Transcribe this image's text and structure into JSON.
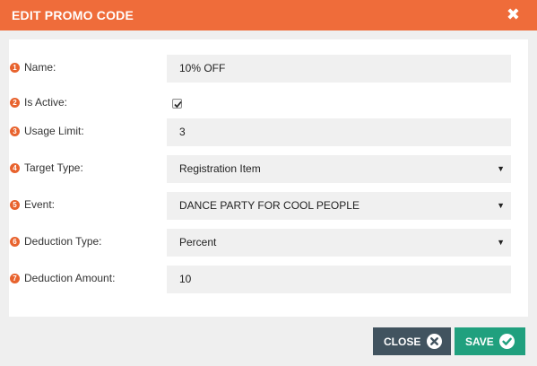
{
  "header": {
    "title": "EDIT PROMO CODE",
    "close_glyph": "✖"
  },
  "form": {
    "name": {
      "number": "1",
      "label": "Name:",
      "value": "10% OFF"
    },
    "is_active": {
      "number": "2",
      "label": "Is Active:",
      "checked": true
    },
    "usage_limit": {
      "number": "3",
      "label": "Usage Limit:",
      "value": "3"
    },
    "target_type": {
      "number": "4",
      "label": "Target Type:",
      "value": "Registration Item"
    },
    "event": {
      "number": "5",
      "label": "Event:",
      "value": "DANCE PARTY FOR COOL PEOPLE"
    },
    "deduction_type": {
      "number": "6",
      "label": "Deduction Type:",
      "value": "Percent"
    },
    "deduction_amount": {
      "number": "7",
      "label": "Deduction Amount:",
      "value": "10"
    },
    "select_caret": "▼"
  },
  "footer": {
    "close_label": "CLOSE",
    "save_label": "SAVE"
  },
  "colors": {
    "header": "#ef6c3a",
    "close_button": "#41535f",
    "save_button": "#20a07e",
    "step_badge": "#e8632e"
  },
  "icons": {
    "header_close": "close-icon",
    "close_button": "x-circle-icon",
    "save_button": "check-circle-icon"
  }
}
